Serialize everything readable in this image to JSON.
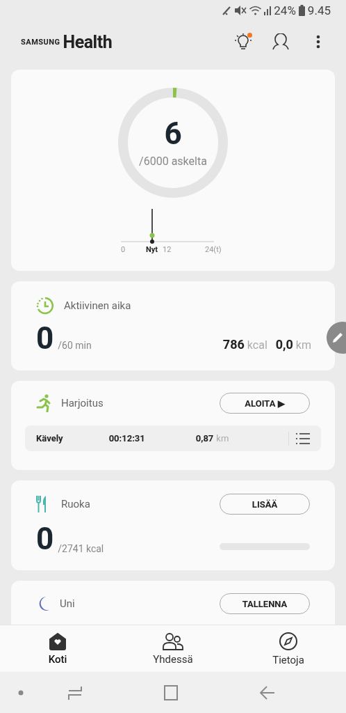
{
  "status_bar": {
    "battery": "24%",
    "time": "9.45"
  },
  "app_bar": {
    "brand": "SAMSUNG",
    "title": "Health",
    "tips_badge": true
  },
  "steps": {
    "count": "6",
    "goal": "/6000 askelta",
    "timeline": {
      "now": "Nyt",
      "ticks": [
        "0",
        "12",
        "24(t)"
      ]
    }
  },
  "active_time": {
    "title": "Aktiivinen aika",
    "value": "0",
    "goal": "/60 min",
    "calories": "786",
    "calories_unit": "kcal",
    "distance": "0,0",
    "distance_unit": "km"
  },
  "exercise": {
    "title": "Harjoitus",
    "button": "ALOITA ▶",
    "last": {
      "type": "Kävely",
      "duration": "00:12:31",
      "distance": "0,87",
      "unit": "km"
    }
  },
  "food": {
    "title": "Ruoka",
    "button": "LISÄÄ",
    "value": "0",
    "goal": "/2741 kcal",
    "level": 0
  },
  "sleep": {
    "title": "Uni",
    "button": "TALLENNA"
  },
  "bottom_nav": [
    {
      "label": "Koti",
      "selected": true
    },
    {
      "label": "Yhdessä",
      "selected": false
    },
    {
      "label": "Tietoja",
      "selected": false
    }
  ]
}
